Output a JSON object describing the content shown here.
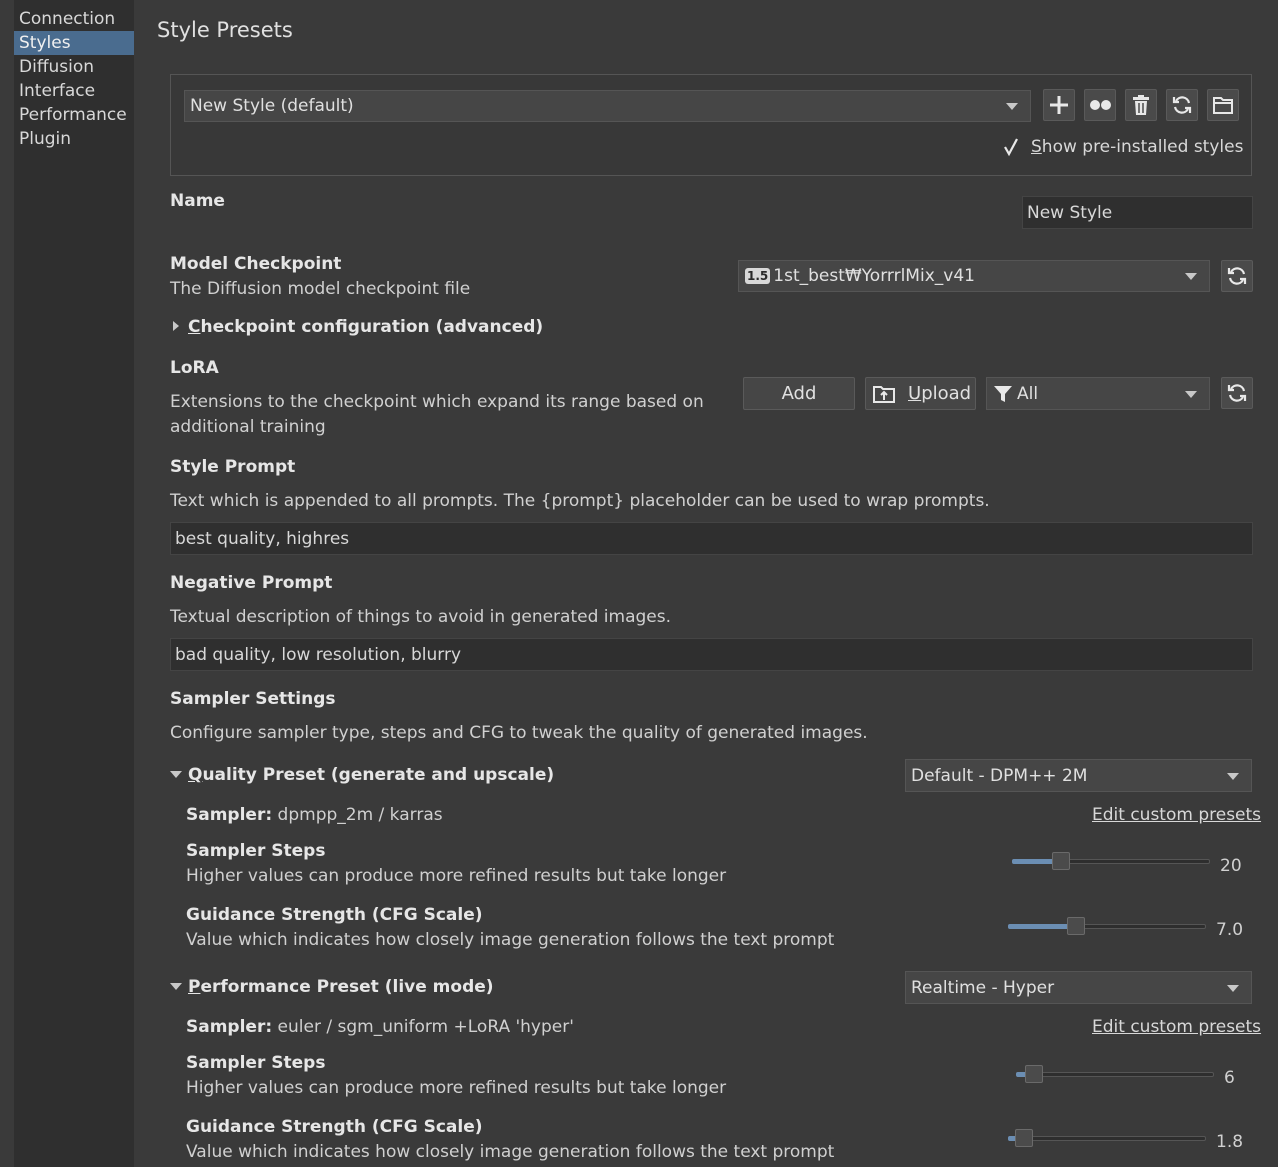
{
  "sidebar": {
    "items": [
      {
        "label": "Connection",
        "active": false
      },
      {
        "label": "Styles",
        "active": true
      },
      {
        "label": "Diffusion",
        "active": false
      },
      {
        "label": "Interface",
        "active": false
      },
      {
        "label": "Performance",
        "active": false
      },
      {
        "label": "Plugin",
        "active": false
      }
    ]
  },
  "page": {
    "title": "Style Presets"
  },
  "style_selector": {
    "value": "New Style (default)",
    "icons": [
      "add-icon",
      "duplicate-icon",
      "delete-icon",
      "refresh-icon",
      "folder-icon"
    ],
    "show_preinstalled_label": "Show pre-installed styles",
    "show_preinstalled_checked": true
  },
  "name": {
    "label": "Name",
    "value": "New Style"
  },
  "checkpoint": {
    "label": "Model Checkpoint",
    "description": "The Diffusion model checkpoint file",
    "badge": "1.5",
    "value": "1st_best₩YorrrlMix_v41",
    "config_label": "Checkpoint configuration (advanced)"
  },
  "lora": {
    "label": "LoRA",
    "description_line1": "Extensions to the checkpoint which expand its range based on",
    "description_line2": "additional training",
    "add_label": "Add",
    "upload_label": "Upload",
    "filter_value": "All"
  },
  "style_prompt": {
    "label": "Style Prompt",
    "description": "Text which is appended to all prompts. The {prompt} placeholder can be used to wrap prompts.",
    "value": "best quality, highres"
  },
  "negative_prompt": {
    "label": "Negative Prompt",
    "description": "Textual description of things to avoid in generated images.",
    "value": "bad quality, low resolution, blurry"
  },
  "sampler_settings": {
    "label": "Sampler Settings",
    "description": "Configure sampler type, steps and CFG to tweak the quality of generated images."
  },
  "quality_preset": {
    "label": "Quality Preset (generate and upscale)",
    "value": "Default - DPM++ 2M",
    "sampler_label": "Sampler:",
    "sampler_value": "dpmpp_2m / karras",
    "edit_link": "Edit custom presets",
    "steps_label": "Sampler Steps",
    "steps_desc": "Higher values can produce more refined results but take longer",
    "steps_value": "20",
    "steps_fraction": 0.22,
    "cfg_label": "Guidance Strength (CFG Scale)",
    "cfg_desc": "Value which indicates how closely image generation follows the text prompt",
    "cfg_value": "7.0",
    "cfg_fraction": 0.33
  },
  "performance_preset": {
    "label": "Performance Preset (live mode)",
    "value": "Realtime - Hyper",
    "sampler_label": "Sampler:",
    "sampler_value": "euler / sgm_uniform  +LoRA 'hyper'",
    "edit_link": "Edit custom presets",
    "steps_label": "Sampler Steps",
    "steps_desc": "Higher values can produce more refined results but take longer",
    "steps_value": "6",
    "steps_fraction": 0.05,
    "cfg_label": "Guidance Strength (CFG Scale)",
    "cfg_desc": "Value which indicates how closely image generation follows the text prompt",
    "cfg_value": "1.8",
    "cfg_fraction": 0.04
  },
  "colors": {
    "accent": "#4a6c8f",
    "slider_fill": "#6b8eb3",
    "background": "#3a3a3a"
  }
}
